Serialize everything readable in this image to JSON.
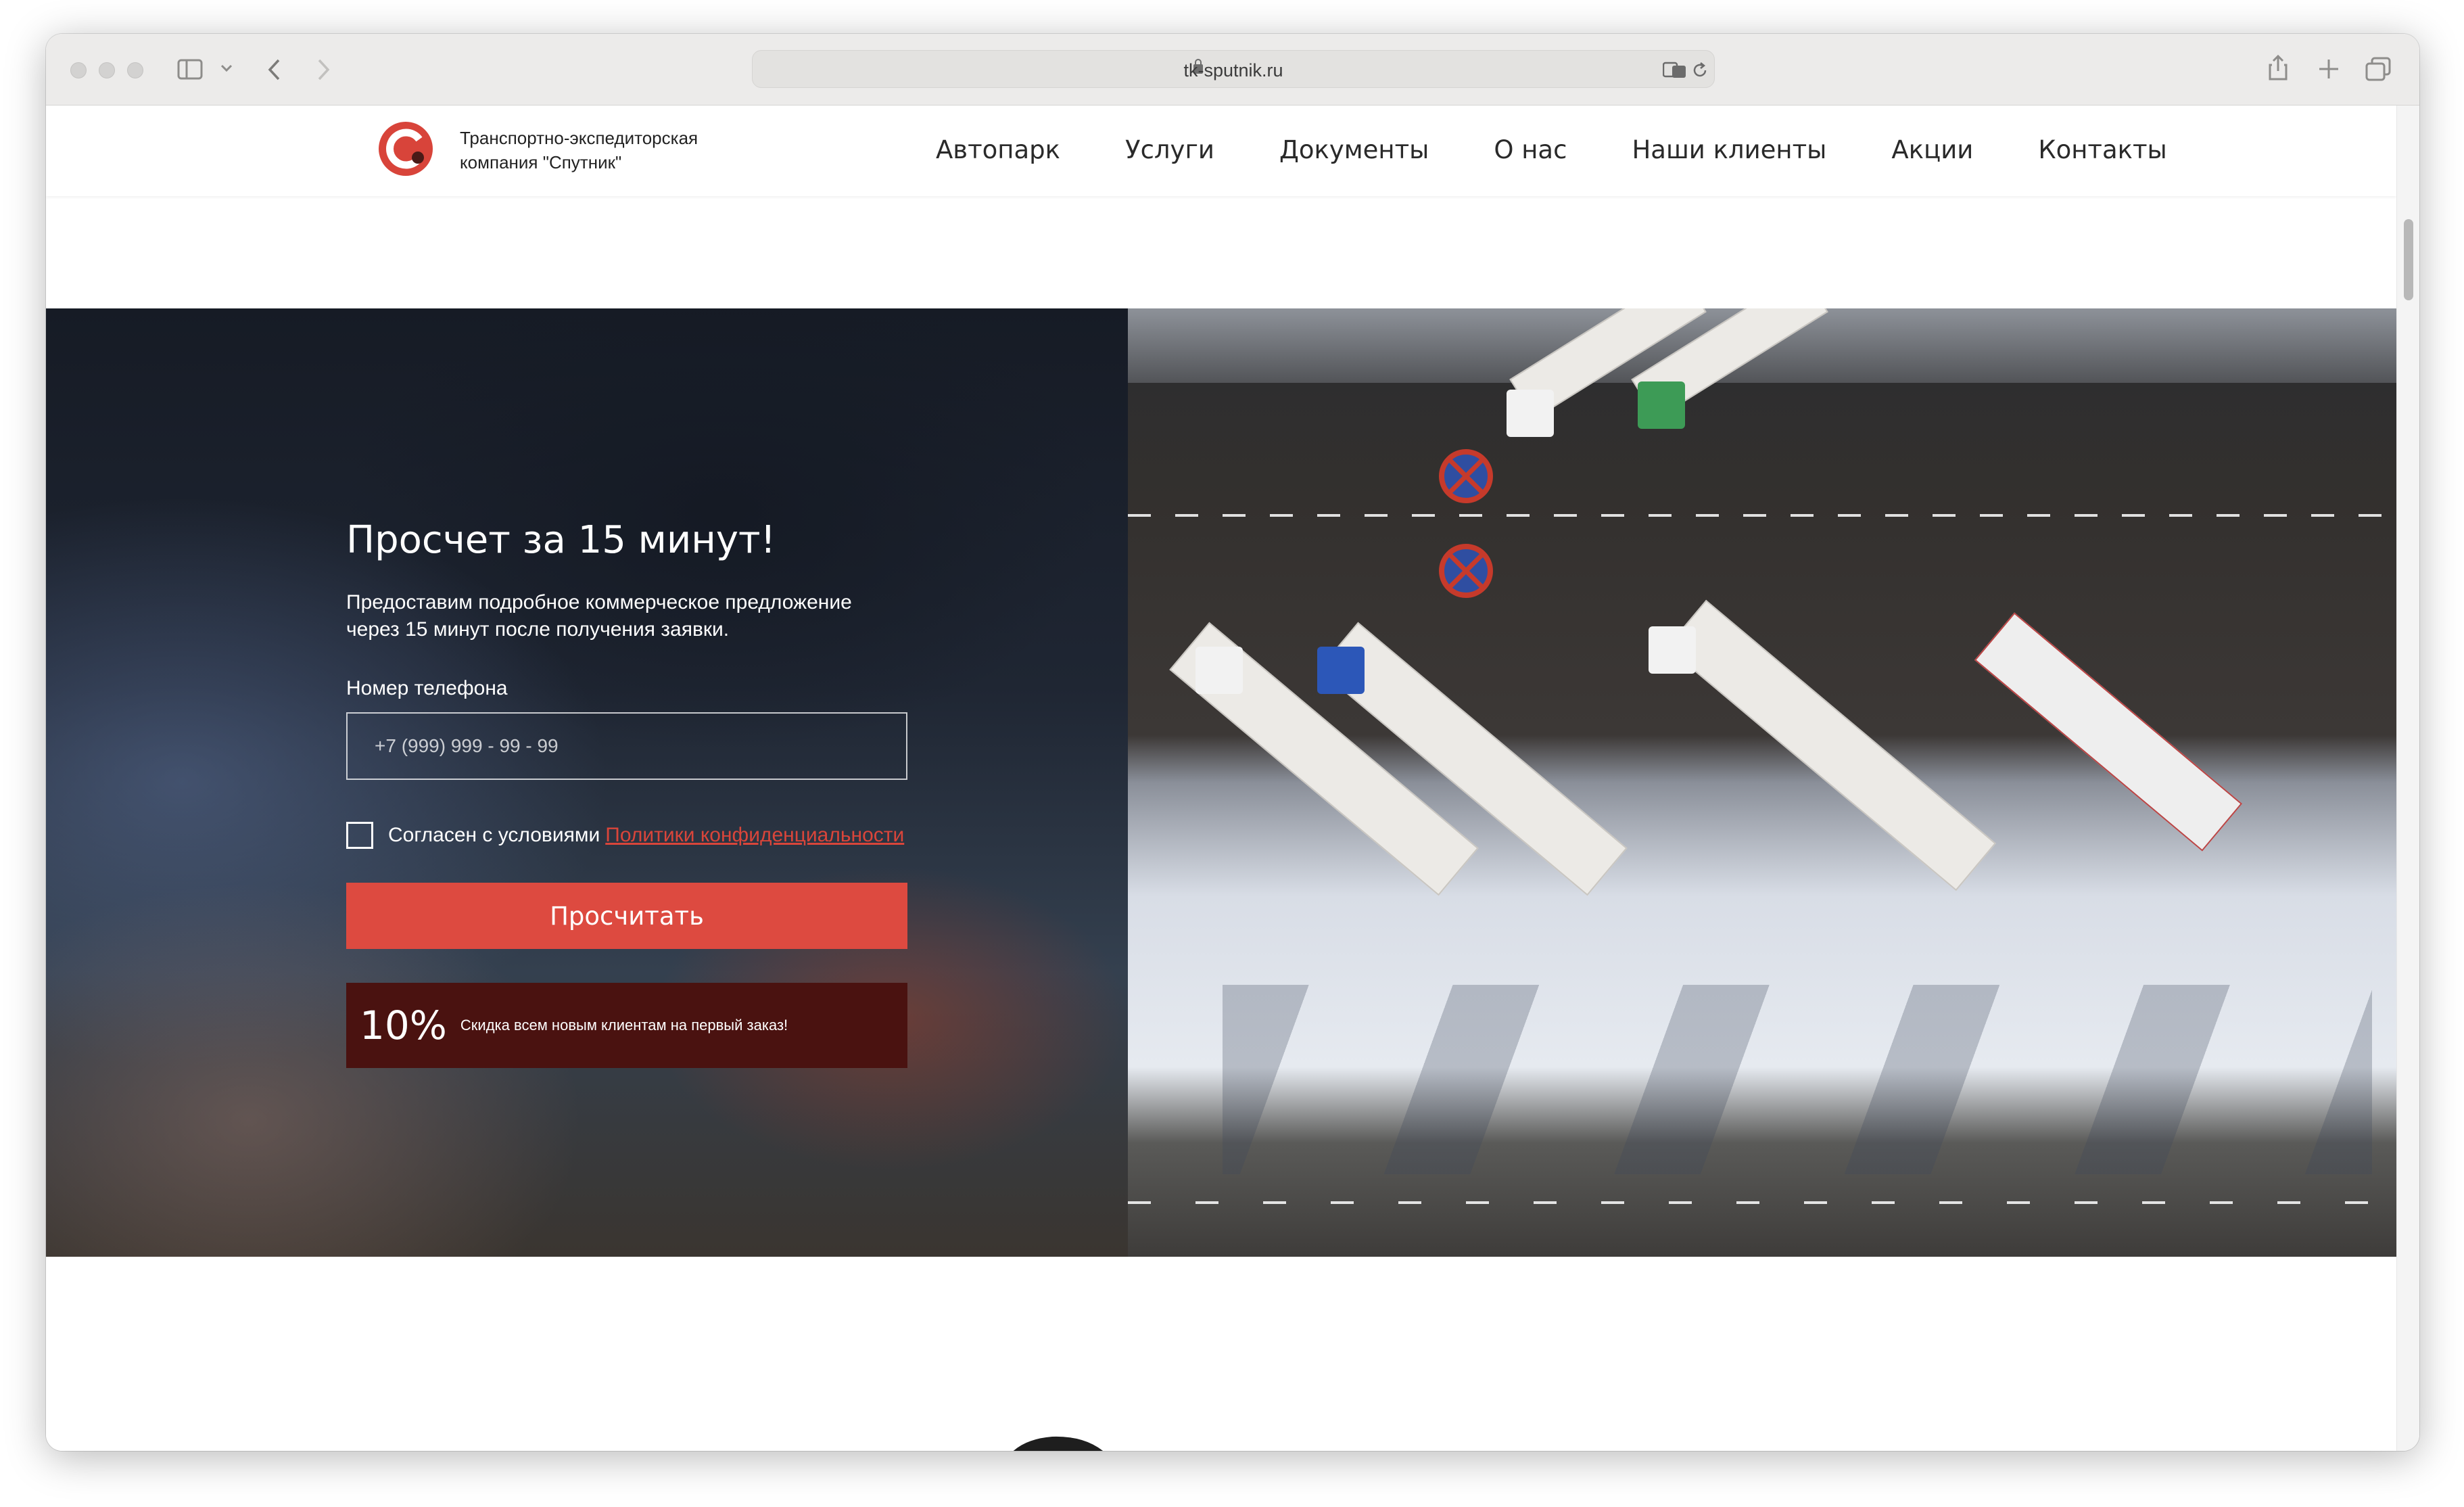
{
  "browser": {
    "url": "tk-sputnik.ru"
  },
  "header": {
    "brand_line1": "Транспортно-экспедиторская",
    "brand_line2": "компания \"Спутник\"",
    "nav": [
      {
        "label": "Автопарк"
      },
      {
        "label": "Услуги"
      },
      {
        "label": "Документы"
      },
      {
        "label": "О нас"
      },
      {
        "label": "Наши клиенты"
      },
      {
        "label": "Акции"
      },
      {
        "label": "Контакты"
      }
    ]
  },
  "hero": {
    "title": "Просчет за 15 минут!",
    "subtitle_line1": "Предоставим подробное коммерческое предложение",
    "subtitle_line2": "через 15 минут после получения заявки.",
    "phone_label": "Номер телефона",
    "phone_placeholder": "+7 (999) 999 - 99 - 99",
    "agree_text": "Согласен с условиями",
    "policy_link": "Политики конфиденциальности",
    "submit_label": "Просчитать",
    "promo_value": "10%",
    "promo_text": "Скидка всем новым клиентам на первый заказ!"
  },
  "colors": {
    "accent": "#dd4a40",
    "promo_bg": "#4a1210",
    "logo_red": "#d8443a"
  }
}
